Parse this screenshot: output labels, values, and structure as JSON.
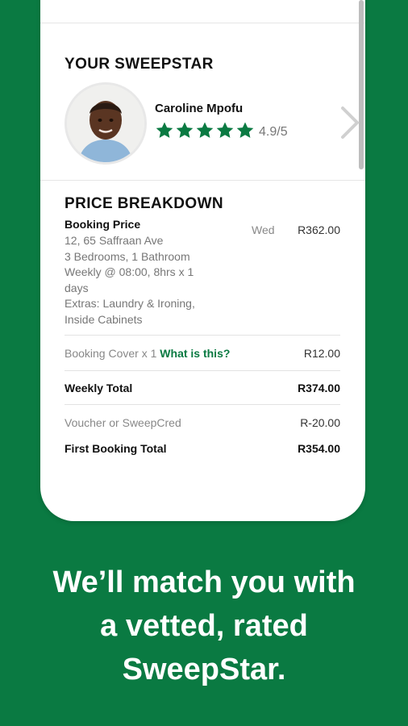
{
  "sweepstar": {
    "title": "YOUR SWEEPSTAR",
    "name": "Caroline Mpofu",
    "stars": 5,
    "rating": "4.9/5"
  },
  "breakdown": {
    "title": "PRICE  BREAKDOWN",
    "booking_label": "Booking Price",
    "day": "Wed",
    "booking_amount": "R362.00",
    "details": [
      "12, 65 Saffraan Ave",
      "3 Bedrooms, 1 Bathroom",
      "Weekly @ 08:00, 8hrs x 1",
      "days",
      "Extras: Laundry & Ironing,",
      "Inside Cabinets"
    ],
    "cover_label": "Booking Cover x 1",
    "cover_link": "What is this?",
    "cover_amount": "R12.00",
    "weekly_label": "Weekly Total",
    "weekly_amount": "R374.00",
    "voucher_label": "Voucher or SweepCred",
    "voucher_amount": "R-20.00",
    "first_label": "First Booking Total",
    "first_amount": "R354.00"
  },
  "tagline": {
    "line1": "We’ll match you with",
    "line2": "a vetted, rated",
    "line3": "SweepStar."
  },
  "colors": {
    "brand_green": "#0a7a42",
    "star_green": "#0a7a42"
  }
}
